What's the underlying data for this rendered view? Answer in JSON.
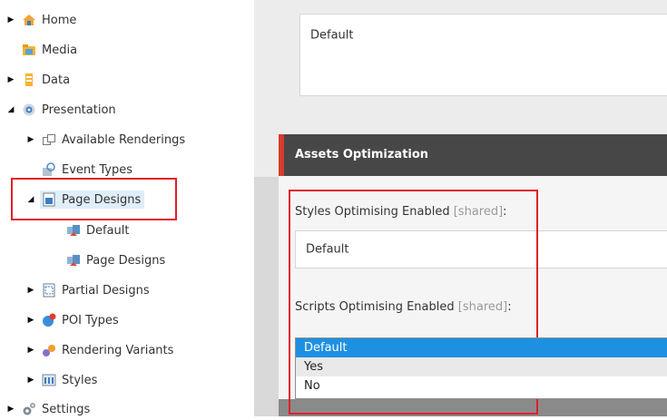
{
  "tree": {
    "home": "Home",
    "media": "Media",
    "data": "Data",
    "presentation": "Presentation",
    "available_renderings": "Available Renderings",
    "event_types": "Event Types",
    "page_designs": "Page Designs",
    "default": "Default",
    "page_designs_child": "Page Designs",
    "partial_designs": "Partial Designs",
    "poi_types": "POI Types",
    "rendering_variants": "Rendering Variants",
    "styles": "Styles",
    "settings": "Settings"
  },
  "panel": {
    "top_field_value": "Default",
    "section_title": "Assets Optimization",
    "styles_label": "Styles Optimising Enabled",
    "styles_shared": "[shared]",
    "styles_colon": ":",
    "styles_value": "Default",
    "scripts_label": "Scripts Optimising Enabled",
    "scripts_shared": "[shared]",
    "scripts_colon": ":",
    "scripts_options": [
      "Default",
      "Yes",
      "No"
    ]
  },
  "colors": {
    "accent_red": "#d93a2b",
    "selection_blue": "#1e90e1",
    "highlight_red": "#e0202a"
  }
}
